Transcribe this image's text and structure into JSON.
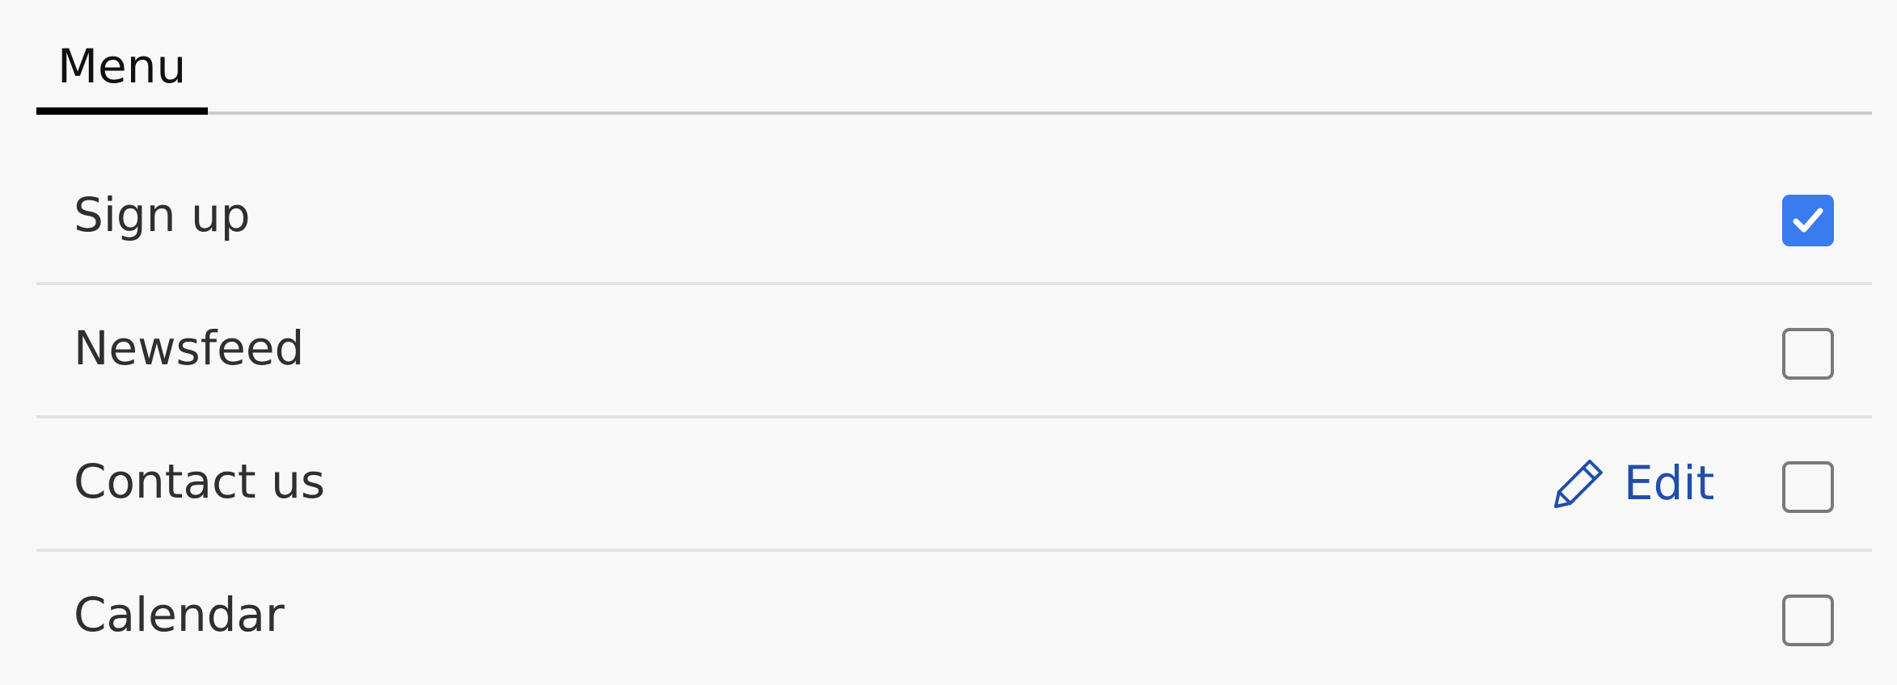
{
  "tabs": [
    {
      "label": "Menu",
      "active": true
    }
  ],
  "menu_items": [
    {
      "label": "Sign up",
      "checked": true
    },
    {
      "label": "Newsfeed",
      "checked": false
    },
    {
      "label": "Contact us",
      "checked": false,
      "edit_label": "Edit",
      "edit_icon": "pencil-icon"
    },
    {
      "label": "Calendar",
      "checked": false
    }
  ],
  "colors": {
    "accent": "#3a7bf0",
    "link": "#1f4fa8",
    "tab_indicator": "#000000"
  }
}
